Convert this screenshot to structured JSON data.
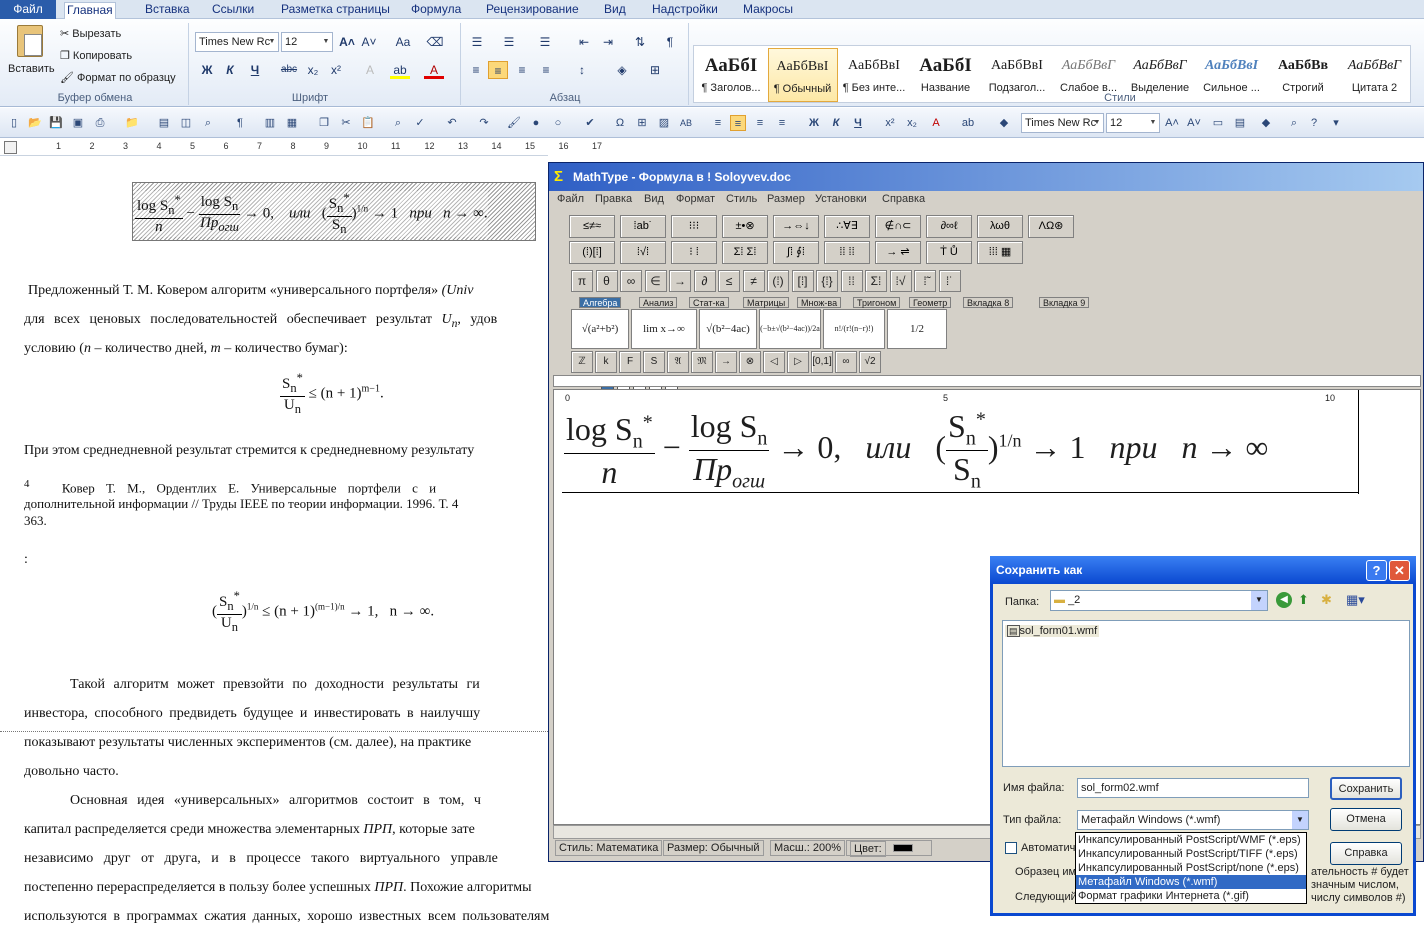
{
  "word": {
    "tabs": [
      "Файл",
      "Главная",
      "Вставка",
      "Ссылки",
      "Разметка страницы",
      "Формула",
      "Рецензирование",
      "Вид",
      "Надстройки",
      "Макросы"
    ],
    "clipboard": {
      "paste": "Вставить",
      "cut": "Вырезать",
      "copy": "Копировать",
      "format_painter": "Формат по образцу",
      "group": "Буфер обмена"
    },
    "font": {
      "name": "Times New Rc",
      "size": "12",
      "group": "Шрифт"
    },
    "paragraph_group": "Абзац",
    "styles_group": "Стили",
    "styles": [
      {
        "sample": "АаБбІ",
        "label": "¶ Заголов..."
      },
      {
        "sample": "АаБбВвІ",
        "label": "¶ Обычный"
      },
      {
        "sample": "АаБбВвІ",
        "label": "¶ Без инте..."
      },
      {
        "sample": "АаБбІ",
        "label": "Название"
      },
      {
        "sample": "АаБбВвІ",
        "label": "Подзагол..."
      },
      {
        "sample": "АаБбВвГ",
        "label": "Слабое в..."
      },
      {
        "sample": "АаБбВвГ",
        "label": "Выделение"
      },
      {
        "sample": "АаБбВвІ",
        "label": "Сильное ..."
      },
      {
        "sample": "АаБбВв",
        "label": "Строгий"
      },
      {
        "sample": "АаБбВвГ",
        "label": "Цитата 2"
      }
    ],
    "toolbar_font": {
      "name": "Times New Rc",
      "size": "12"
    },
    "ruler_marks": [
      "1",
      "2",
      "3",
      "4",
      "5",
      "6",
      "7",
      "8",
      "9",
      "10",
      "11",
      "12",
      "13",
      "14",
      "15",
      "16",
      "17"
    ]
  },
  "document": {
    "p1": "Предложенный Т. М. Ковером алгоритм «универсального портфеля»",
    "p1_it": "(Univ",
    "p2a": "для всех ценовых последовательностей обеспечивает результат",
    "p2b": "U",
    "p2c": ", удов",
    "p3a": "условию (",
    "p3b": "n",
    "p3c": " – количество дней,",
    "p3d": "m",
    "p3e": " – количество бумаг):",
    "p4": "При этом среднедневной результат стремится к среднедневному результату",
    "fn_num": "4",
    "fn1": "Ковер Т. М., Ордентлих Е. Универсальные портфели с и",
    "fn2": "дополнительной информации // Труды IEEE по теории информации. 1996. Т. 4",
    "fn3": "363.",
    "colon": ":",
    "p5": "Такой алгоритм может превзойти по доходности результаты ги",
    "p6": "инвестора, способного предвидеть будущее и инвестировать в наилучшу",
    "p7": "показывают результаты численных экспериментов (см. далее), на практике",
    "p8": "довольно часто.",
    "p9a": "Основная идея «универсальных» алгоритмов состоит в том, ч",
    "p10a": "капитал распределяется среди множества элементарных",
    "p10b": "ПРП",
    "p10c": ", которые зате",
    "p11": "независимо друг от друга, и в процессе такого виртуального управле",
    "p12a": "постепенно перераспределяется в пользу более успешных",
    "p12b": "ПРП",
    "p12c": ". Похожие алгоритмы",
    "p13": "используются в программах сжатия данных, хорошо известных всем пользователям",
    "eq_or": "или",
    "eq_at": "при",
    "eq_pr": "Пр",
    "eq_sub": "огш"
  },
  "mathtype": {
    "title": "MathType - Формула в ! Soloyvev.doc",
    "menu": [
      "Файл",
      "Правка",
      "Вид",
      "Формат",
      "Стиль",
      "Размер",
      "Установки",
      "Справка"
    ],
    "tabs": [
      "Алгебра",
      "Анализ",
      "Стат-ка",
      "Матрицы",
      "Множ-ва",
      "Тригоном",
      "Геометр",
      "Вкладка 8",
      "Вкладка 9"
    ],
    "ruler": [
      "0",
      "5",
      "10"
    ],
    "status": {
      "style": "Стиль: Математика",
      "size": "Размер: Обычный",
      "zoom": "Масш.: 200%",
      "color": "Цвет:"
    }
  },
  "dialog": {
    "title": "Сохранить как",
    "folder_label": "Папка:",
    "folder": "_2",
    "file_item": "sol_form01.wmf",
    "filename_label": "Имя файла:",
    "filename": "sol_form02.wmf",
    "filetype_label": "Тип файла:",
    "filetype": "Метафайл Windows (*.wmf)",
    "save": "Сохранить",
    "cancel": "Отмена",
    "help": "Справка",
    "auto": "Автоматич",
    "sample": "Образец им",
    "next": "Следующий",
    "hint1": "ательность # будет",
    "hint2": "значным числом,",
    "hint3": "числу символов #)",
    "options": [
      "Инкапсулированный PostScript/WMF (*.eps)",
      "Инкапсулированный PostScript/TIFF (*.eps)",
      "Инкапсулированный PostScript/none (*.eps)",
      "Метафайл Windows (*.wmf)",
      "Формат графики Интернета (*.gif)"
    ]
  }
}
